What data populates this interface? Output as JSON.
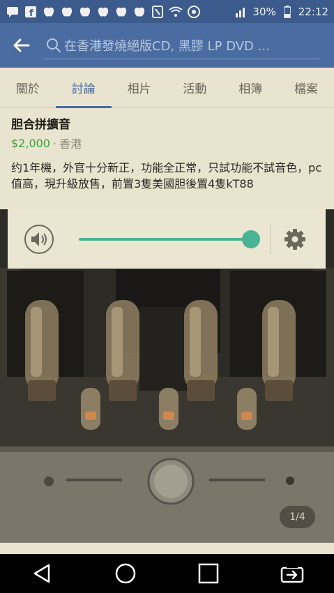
{
  "status_bar": {
    "battery_percent": "30%",
    "time": "22:12",
    "signal": "4G"
  },
  "app_bar": {
    "search_placeholder": "在香港發燒絕版CD, 黑膠 LP DVD ..."
  },
  "tabs": [
    {
      "label": "關於",
      "active": false
    },
    {
      "label": "討論",
      "active": true
    },
    {
      "label": "相片",
      "active": false
    },
    {
      "label": "活動",
      "active": false
    },
    {
      "label": "相簿",
      "active": false
    },
    {
      "label": "檔案",
      "active": false
    }
  ],
  "post": {
    "title": "胆合拼擴音",
    "price": "$2,000",
    "separator": "·",
    "location": "香港",
    "body": "约1年機，外官十分新正，功能全正常，只試功能不試音色，pc值高，現升級放售，前置3隻美國胆後置4隻kT88"
  },
  "media": {
    "volume_level": 0.95,
    "page_indicator": "1/4"
  },
  "colors": {
    "brand": "#4a6ca1",
    "price": "#3ea03a",
    "slider": "#4ab394"
  },
  "icons": [
    "back-arrow-icon",
    "search-icon",
    "speaker-icon",
    "gear-icon",
    "nav-back-icon",
    "nav-home-icon",
    "nav-recents-icon",
    "nav-rotate-icon"
  ]
}
